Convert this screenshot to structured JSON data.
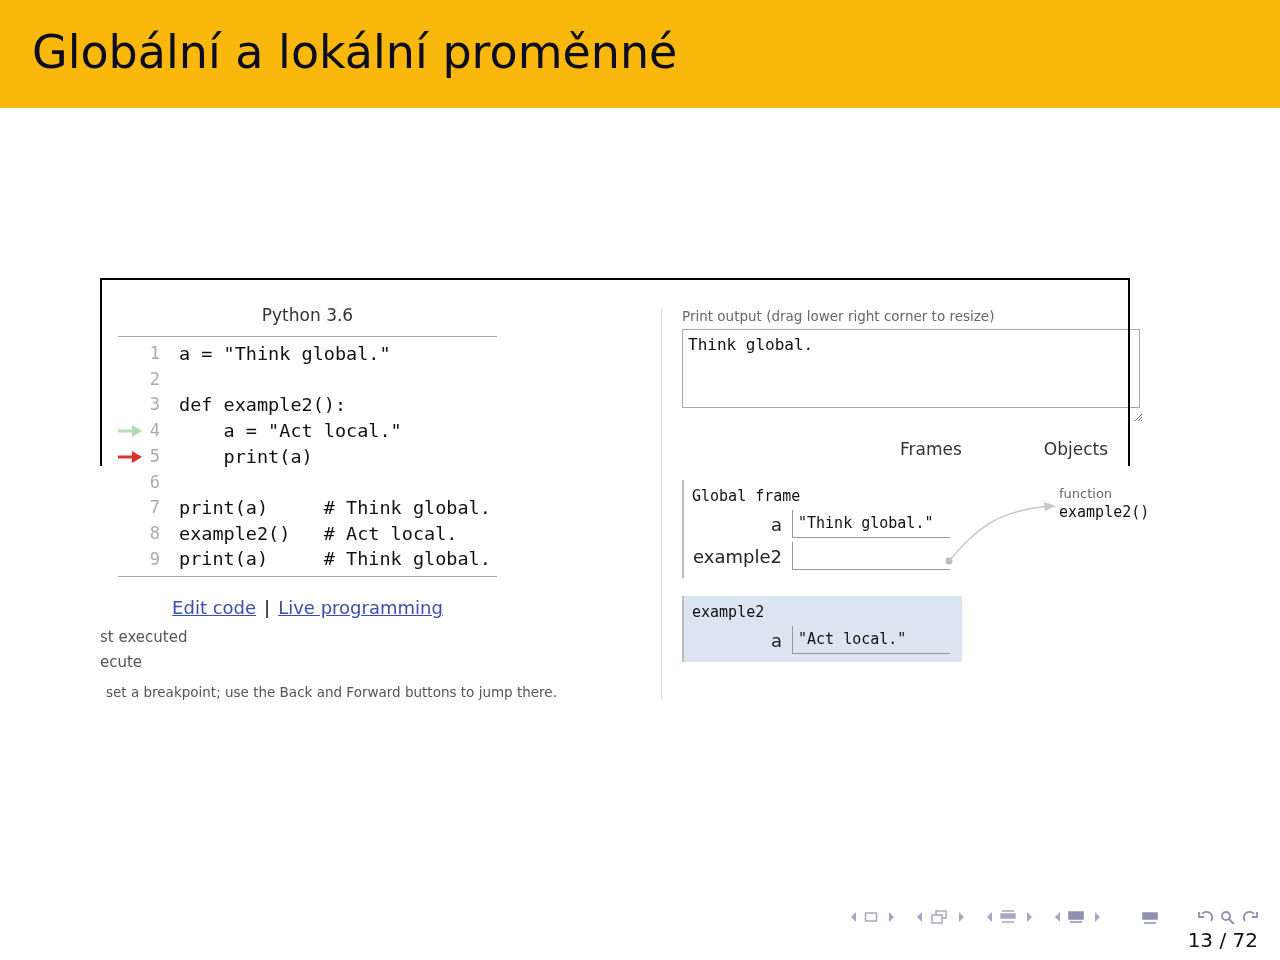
{
  "title": "Globální a lokální proměnné",
  "visualizer": {
    "language": "Python 3.6",
    "lines": [
      {
        "number": "1",
        "code": "a = \"Think global.\"",
        "just_executed": false,
        "next_to_execute": false
      },
      {
        "number": "2",
        "just_executed": false,
        "next_to_execute": false
      },
      {
        "number": "3",
        "code": "def example2():",
        "just_executed": false,
        "next_to_execute": false
      },
      {
        "number": "4",
        "code": "    a = \"Act local.\"",
        "just_executed": true,
        "next_to_execute": false
      },
      {
        "number": "5",
        "code": "    print(a)",
        "just_executed": false,
        "next_to_execute": true
      },
      {
        "number": "6",
        "just_executed": false,
        "next_to_execute": false
      },
      {
        "number": "7",
        "code": "print(a)     # Think global.",
        "just_executed": false,
        "next_to_execute": false
      },
      {
        "number": "8",
        "code": "example2()   # Act local.",
        "just_executed": false,
        "next_to_execute": false
      },
      {
        "number": "9",
        "code": "print(a)     # Think global.",
        "just_executed": false,
        "next_to_execute": false
      }
    ],
    "links": [
      {
        "label": "Edit code"
      },
      {
        "label": "Live programming"
      }
    ],
    "link_separator": "|",
    "legend": [
      "st executed",
      "ecute"
    ],
    "hint": "set a breakpoint; use the Back and Forward buttons to jump there.",
    "print_output_label": "Print output (drag lower right corner to resize)",
    "print_output": "Think global.",
    "frames_heading": "Frames",
    "objects_heading": "Objects",
    "frames": [
      {
        "title": "Global frame",
        "active": false,
        "vars": [
          {
            "name": "a",
            "kind": "string",
            "value": "\"Think global.\""
          },
          {
            "name": "example2",
            "kind": "pointer"
          }
        ]
      },
      {
        "title": "example2",
        "active": true,
        "vars": [
          {
            "name": "a",
            "kind": "string",
            "value": "\"Act local.\""
          }
        ]
      }
    ],
    "object": {
      "type": "function",
      "name": "example2()"
    }
  },
  "page_number": "13 / 72"
}
